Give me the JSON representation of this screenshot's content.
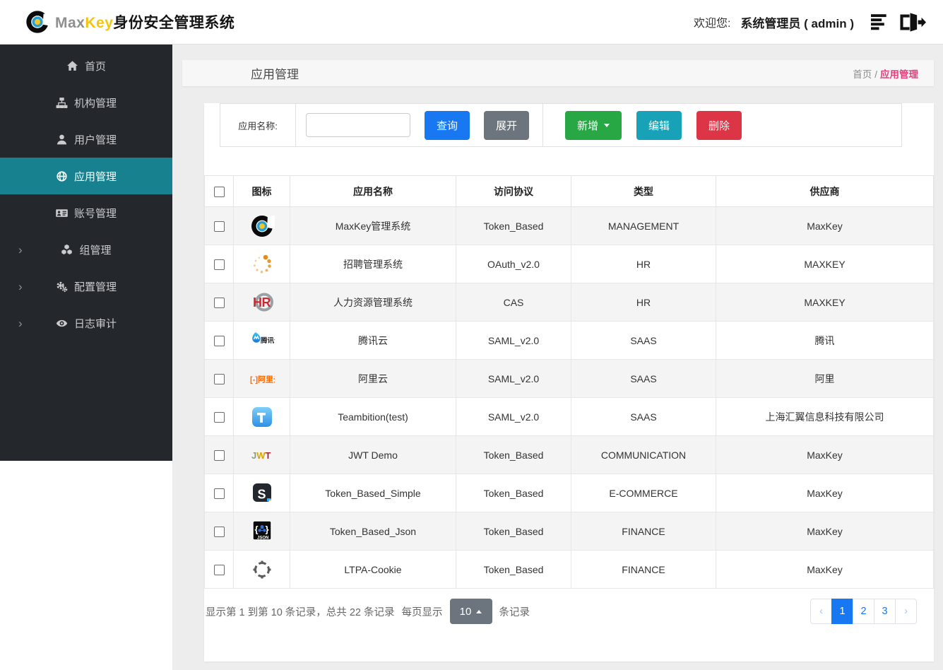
{
  "colors": {
    "primary": "#1778f2",
    "secondary": "#6c757d",
    "success": "#28a745",
    "info": "#17a2b8",
    "danger": "#dc3545",
    "sidebar-active": "#17818f",
    "breadcrumb": "#e0437c",
    "brand-yellow": "#f3c50f"
  },
  "header": {
    "logo_icon": "maxkey-logo-icon",
    "brand_max": "Max",
    "brand_key": "Key",
    "brand_suffix": "身份安全管理系统",
    "welcome_label": "欢迎您:",
    "user_display": "系统管理员 ( admin )",
    "list_icon": "list-icon",
    "logout_icon": "sign-out-icon"
  },
  "sidebar": {
    "items": [
      {
        "key": "home",
        "label": "首页",
        "icon": "home-icon",
        "active": false,
        "expandable": false
      },
      {
        "key": "org",
        "label": "机构管理",
        "icon": "sitemap-icon",
        "active": false,
        "expandable": false
      },
      {
        "key": "user",
        "label": "用户管理",
        "icon": "user-icon",
        "active": false,
        "expandable": false
      },
      {
        "key": "app",
        "label": "应用管理",
        "icon": "globe-icon",
        "active": true,
        "expandable": false
      },
      {
        "key": "account",
        "label": "账号管理",
        "icon": "id-card-icon",
        "active": false,
        "expandable": false
      },
      {
        "key": "group",
        "label": "组管理",
        "icon": "cubes-icon",
        "active": false,
        "expandable": true
      },
      {
        "key": "config",
        "label": "配置管理",
        "icon": "gears-icon",
        "active": false,
        "expandable": true
      },
      {
        "key": "audit",
        "label": "日志审计",
        "icon": "eye-icon",
        "active": false,
        "expandable": true
      }
    ]
  },
  "page": {
    "title": "应用管理",
    "breadcrumb_root": "首页",
    "breadcrumb_separator": "/",
    "breadcrumb_current": "应用管理"
  },
  "toolbar": {
    "search_label": "应用名称:",
    "search_value": "",
    "query_label": "查询",
    "expand_label": "展开",
    "add_label": "新增",
    "edit_label": "编辑",
    "delete_label": "删除"
  },
  "table": {
    "columns": [
      "图标",
      "应用名称",
      "访问协议",
      "类型",
      "供应商"
    ],
    "rows": [
      {
        "icon": "maxkey-app-icon",
        "name": "MaxKey管理系统",
        "protocol": "Token_Based",
        "category": "MANAGEMENT",
        "vendor": "MaxKey"
      },
      {
        "icon": "spinner-dots-icon",
        "name": "招聘管理系统",
        "protocol": "OAuth_v2.0",
        "category": "HR",
        "vendor": "MAXKEY"
      },
      {
        "icon": "hr-logo-icon",
        "name": "人力资源管理系统",
        "protocol": "CAS",
        "category": "HR",
        "vendor": "MAXKEY"
      },
      {
        "icon": "tencent-cloud-icon",
        "name": "腾讯云",
        "protocol": "SAML_v2.0",
        "category": "SAAS",
        "vendor": "腾讯"
      },
      {
        "icon": "aliyun-icon",
        "name": "阿里云",
        "protocol": "SAML_v2.0",
        "category": "SAAS",
        "vendor": "阿里"
      },
      {
        "icon": "teambition-icon",
        "name": "Teambition(test)",
        "protocol": "SAML_v2.0",
        "category": "SAAS",
        "vendor": "上海汇翼信息科技有限公司"
      },
      {
        "icon": "jwt-icon",
        "name": "JWT Demo",
        "protocol": "Token_Based",
        "category": "COMMUNICATION",
        "vendor": "MaxKey"
      },
      {
        "icon": "s-dark-icon",
        "name": "Token_Based_Simple",
        "protocol": "Token_Based",
        "category": "E-COMMERCE",
        "vendor": "MaxKey"
      },
      {
        "icon": "json-icon",
        "name": "Token_Based_Json",
        "protocol": "Token_Based",
        "category": "FINANCE",
        "vendor": "MaxKey"
      },
      {
        "icon": "ltpa-crosshair-icon",
        "name": "LTPA-Cookie",
        "protocol": "Token_Based",
        "category": "FINANCE",
        "vendor": "MaxKey"
      }
    ]
  },
  "pagination": {
    "info_text": "显示第 1 到第 10 条记录，总共 22 条记录",
    "page_size_label_pre": "每页显示",
    "page_size": "10",
    "page_size_label_post": "条记录",
    "prev": "‹",
    "next": "›",
    "pages": [
      "1",
      "2",
      "3"
    ],
    "active_page": "1"
  }
}
